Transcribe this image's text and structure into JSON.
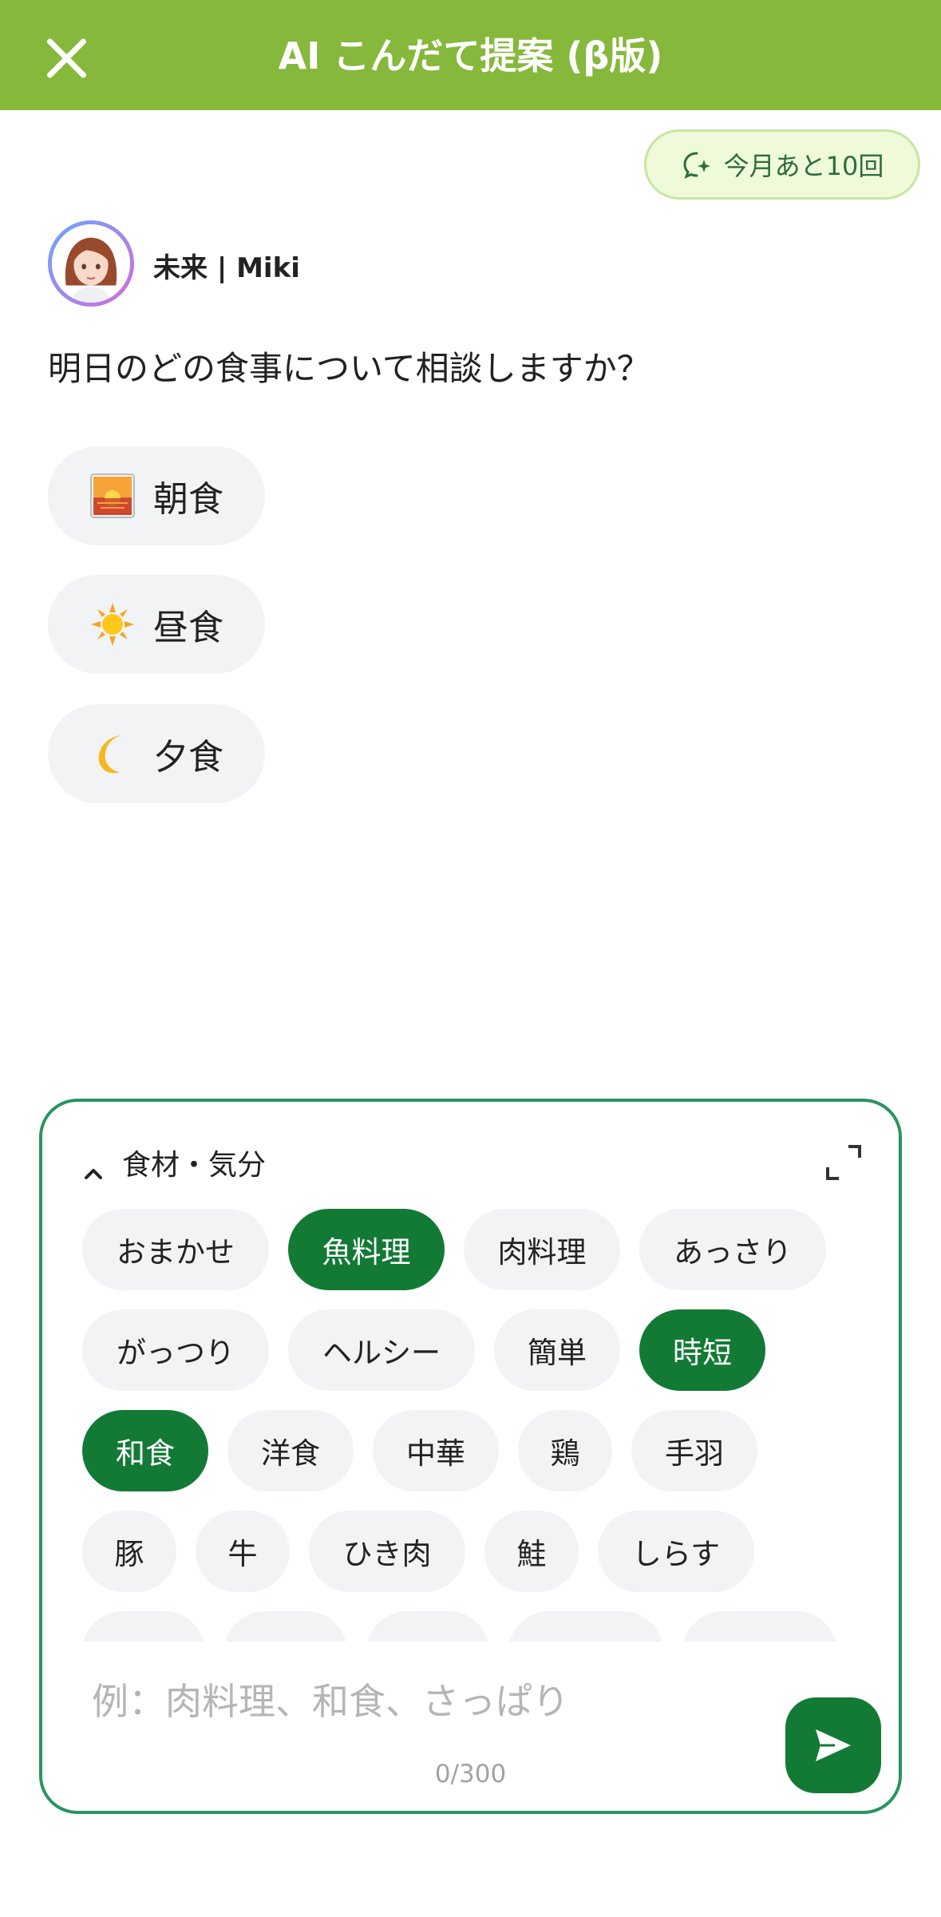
{
  "header": {
    "title": "AI こんだて提案 (β版)",
    "close_icon": "close-icon"
  },
  "quota": {
    "label": "今月あと10回",
    "icon": "sparkle-chat-icon"
  },
  "bot": {
    "name": "未来 | Miki"
  },
  "question": "明日のどの食事について相談しますか？",
  "meals": [
    {
      "label": "朝食",
      "icon": "sunrise-icon"
    },
    {
      "label": "昼食",
      "icon": "sun-icon"
    },
    {
      "label": "夕食",
      "icon": "crescent-moon-icon"
    }
  ],
  "panel": {
    "title": "食材・気分",
    "rows": [
      [
        {
          "label": "おまかせ",
          "selected": false
        },
        {
          "label": "魚料理",
          "selected": true
        },
        {
          "label": "肉料理",
          "selected": false
        },
        {
          "label": "あっさり",
          "selected": false
        }
      ],
      [
        {
          "label": "がっつり",
          "selected": false
        },
        {
          "label": "ヘルシー",
          "selected": false
        },
        {
          "label": "簡単",
          "selected": false
        },
        {
          "label": "時短",
          "selected": true
        }
      ],
      [
        {
          "label": "和食",
          "selected": true
        },
        {
          "label": "洋食",
          "selected": false
        },
        {
          "label": "中華",
          "selected": false
        },
        {
          "label": "鶏",
          "selected": false
        },
        {
          "label": "手羽",
          "selected": false
        }
      ],
      [
        {
          "label": "豚",
          "selected": false
        },
        {
          "label": "牛",
          "selected": false
        },
        {
          "label": "ひき肉",
          "selected": false
        },
        {
          "label": "鮭",
          "selected": false
        },
        {
          "label": "しらす",
          "selected": false
        }
      ]
    ],
    "input_placeholder": "例：肉料理、和食、さっぱり",
    "input_value": "",
    "counter": "0/300"
  },
  "colors": {
    "header": "#86b83c",
    "selected_tag": "#137a35",
    "panel_border": "#2a9460",
    "quota_bg": "#effadb"
  }
}
